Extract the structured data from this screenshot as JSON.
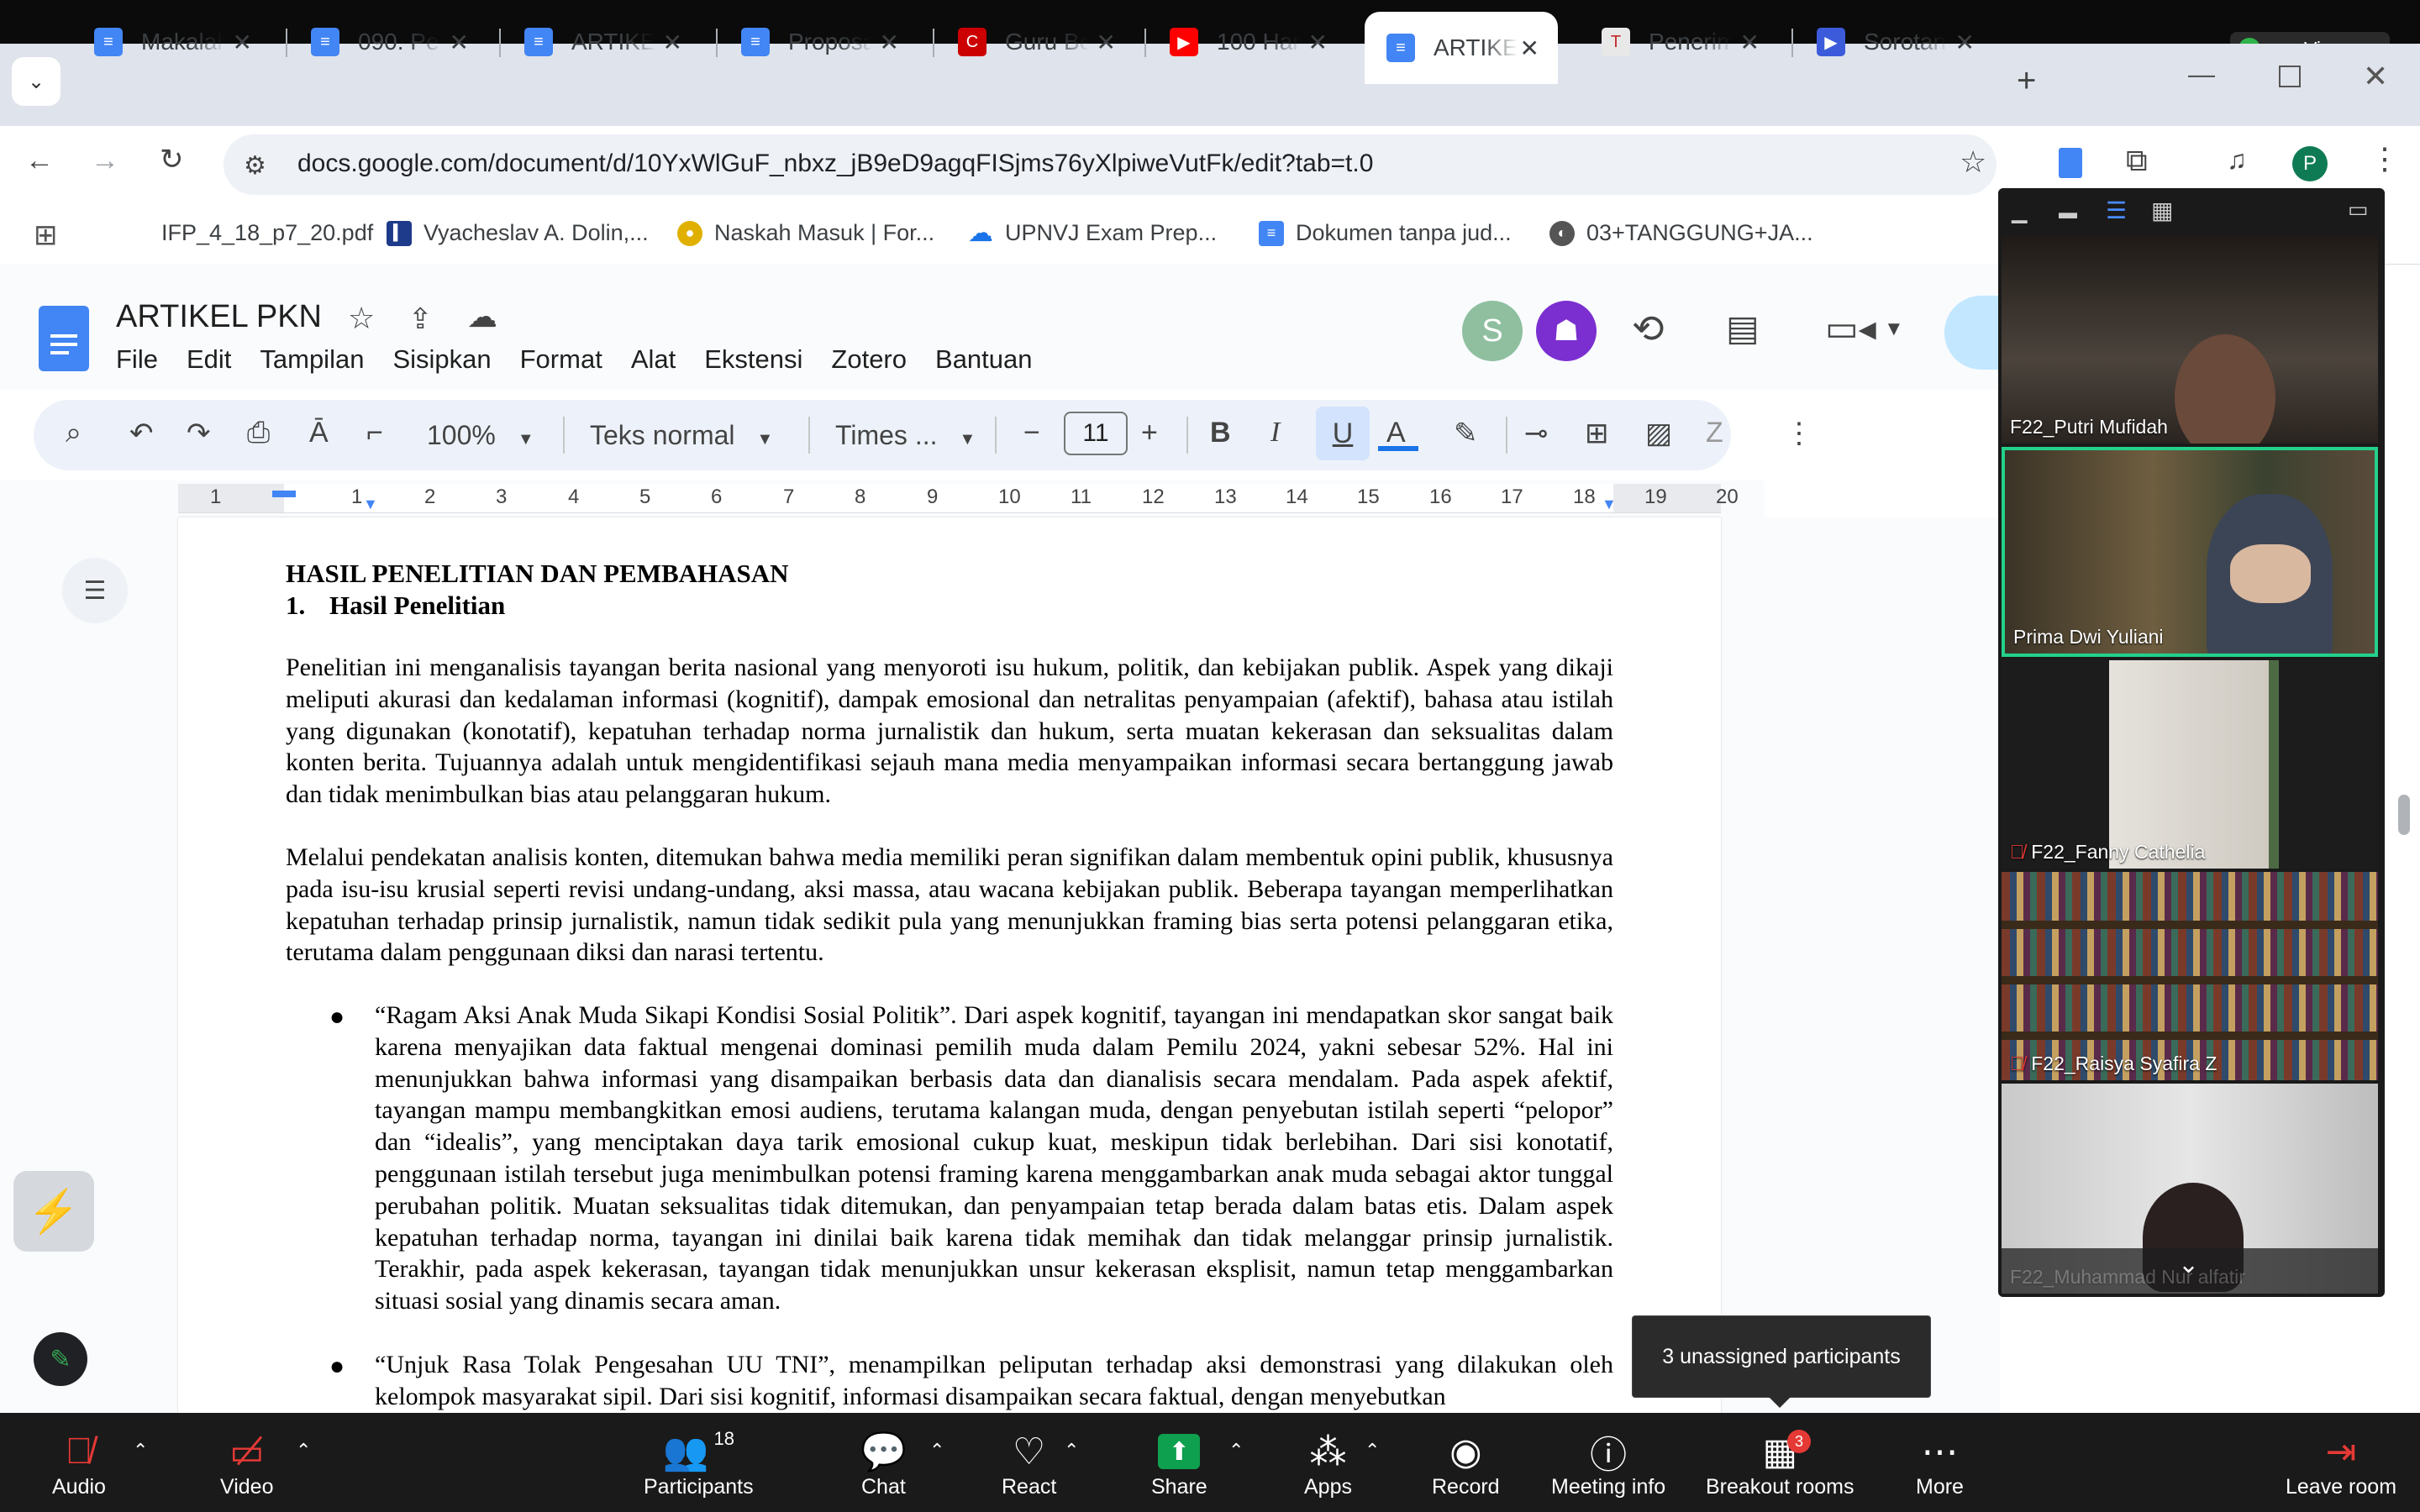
{
  "window": {
    "view_label": "View"
  },
  "tabs": [
    {
      "label": "Makalah",
      "icon": "docs-icon"
    },
    {
      "label": "090. Pe",
      "icon": "docs-icon"
    },
    {
      "label": "ARTIKEL",
      "icon": "docs-icon"
    },
    {
      "label": "Proposal",
      "icon": "docs-icon"
    },
    {
      "label": "Guru Be",
      "icon": "cnn-icon"
    },
    {
      "label": "100 Har",
      "icon": "youtube-icon"
    },
    {
      "label": "ARTIKEL",
      "icon": "docs-icon",
      "active": true
    },
    {
      "label": "Penerim",
      "icon": "tempo-icon"
    },
    {
      "label": "Sorotan",
      "icon": "play-icon"
    }
  ],
  "addressbar": {
    "url": "docs.google.com/document/d/10YxWlGuF_nbxz_jB9eD9agqFISjms76yXlpiweVutFk/edit?tab=t.0"
  },
  "profile_initial": "P",
  "bookmarks": [
    {
      "label": "IFP_4_18_p7_20.pdf"
    },
    {
      "label": "Vyacheslav A. Dolin,..."
    },
    {
      "label": "Naskah Masuk | For..."
    },
    {
      "label": "UPNVJ Exam Prep..."
    },
    {
      "label": "Dokumen tanpa jud..."
    },
    {
      "label": "03+TANGGUNG+JA..."
    }
  ],
  "docs": {
    "title": "ARTIKEL PKN",
    "menu": [
      "File",
      "Edit",
      "Tampilan",
      "Sisipkan",
      "Format",
      "Alat",
      "Ekstensi",
      "Zotero",
      "Bantuan"
    ],
    "toolbar": {
      "zoom": "100%",
      "style": "Teks normal",
      "font": "Times ...",
      "font_size": "11"
    },
    "ruler": [
      "1",
      "1",
      "2",
      "3",
      "4",
      "5",
      "6",
      "7",
      "8",
      "9",
      "10",
      "11",
      "12",
      "13",
      "14",
      "15",
      "16",
      "17",
      "18",
      "19",
      "20"
    ]
  },
  "document": {
    "heading1": "HASIL PENELITIAN DAN PEMBAHASAN",
    "heading2_num": "1.",
    "heading2": "Hasil Penelitian",
    "para1": "Penelitian ini menganalisis tayangan berita nasional yang menyoroti isu hukum, politik, dan kebijakan publik. Aspek yang dikaji meliputi akurasi dan kedalaman informasi (kognitif), dampak emosional dan netralitas penyampaian (afektif), bahasa atau istilah yang digunakan (konotatif), kepatuhan terhadap norma jurnalistik dan hukum, serta muatan kekerasan dan seksualitas dalam konten berita. Tujuannya adalah untuk mengidentifikasi sejauh mana media menyampaikan informasi secara bertanggung jawab dan tidak menimbulkan bias atau pelanggaran hukum.",
    "para2": "Melalui pendekatan analisis konten, ditemukan bahwa media memiliki peran signifikan dalam membentuk opini publik, khususnya pada isu-isu krusial seperti revisi undang-undang, aksi massa, atau wacana kebijakan publik. Beberapa tayangan memperlihatkan kepatuhan terhadap prinsip jurnalistik, namun tidak sedikit pula yang menunjukkan framing bias serta potensi pelanggaran etika, terutama dalam penggunaan diksi dan narasi tertentu.",
    "bullet1": "“Ragam Aksi Anak Muda Sikapi Kondisi Sosial Politik”. Dari aspek kognitif, tayangan ini mendapatkan skor sangat baik karena menyajikan data faktual mengenai dominasi pemilih muda dalam Pemilu 2024, yakni sebesar 52%. Hal ini menunjukkan bahwa informasi yang disampaikan berbasis data dan dianalisis secara mendalam. Pada aspek afektif, tayangan mampu membangkitkan emosi audiens, terutama kalangan muda, dengan penyebutan istilah seperti “pelopor” dan “idealis”, yang menciptakan daya tarik emosional cukup kuat, meskipun tidak berlebihan. Dari sisi konotatif, penggunaan istilah tersebut juga menimbulkan potensi framing karena menggambarkan anak muda sebagai aktor tunggal perubahan politik. Muatan seksualitas tidak ditemukan, dan penyampaian tetap berada dalam batas etis. Dalam aspek kepatuhan terhadap norma, tayangan ini dinilai baik karena tidak memihak dan tidak melanggar prinsip jurnalistik. Terakhir, pada aspek kekerasan, tayangan tidak menunjukkan unsur kekerasan eksplisit, namun tetap menggambarkan situasi sosial yang dinamis secara aman.",
    "bullet2": "“Unjuk Rasa Tolak Pengesahan UU TNI”, menampilkan peliputan terhadap aksi demonstrasi yang dilakukan oleh kelompok masyarakat sipil. Dari sisi kognitif, informasi disampaikan secara faktual, dengan menyebutkan"
  },
  "zoom": {
    "participants": [
      {
        "name": "F22_Putri Mufidah",
        "muted": false
      },
      {
        "name": "Prima Dwi Yuliani",
        "muted": false,
        "speaking": true
      },
      {
        "name": "F22_Fanny Cathelia",
        "muted": true
      },
      {
        "name": "F22_Raisya Syafira Z",
        "muted": true
      },
      {
        "name": "F22_Muhammad Nur alfatir",
        "muted": true
      }
    ],
    "tooltip": "3 unassigned participants",
    "bar": {
      "audio": "Audio",
      "video": "Video",
      "participants": "Participants",
      "participants_count": "18",
      "chat": "Chat",
      "react": "React",
      "share": "Share",
      "apps": "Apps",
      "record": "Record",
      "meeting_info": "Meeting info",
      "breakout": "Breakout rooms",
      "breakout_badge": "3",
      "more": "More",
      "leave": "Leave room"
    }
  },
  "colors": {
    "docs_blue": "#4285f4",
    "share_green": "#0e9f4f",
    "speaking_border": "#23d18b",
    "zoom_bar": "#1a1a1a"
  }
}
